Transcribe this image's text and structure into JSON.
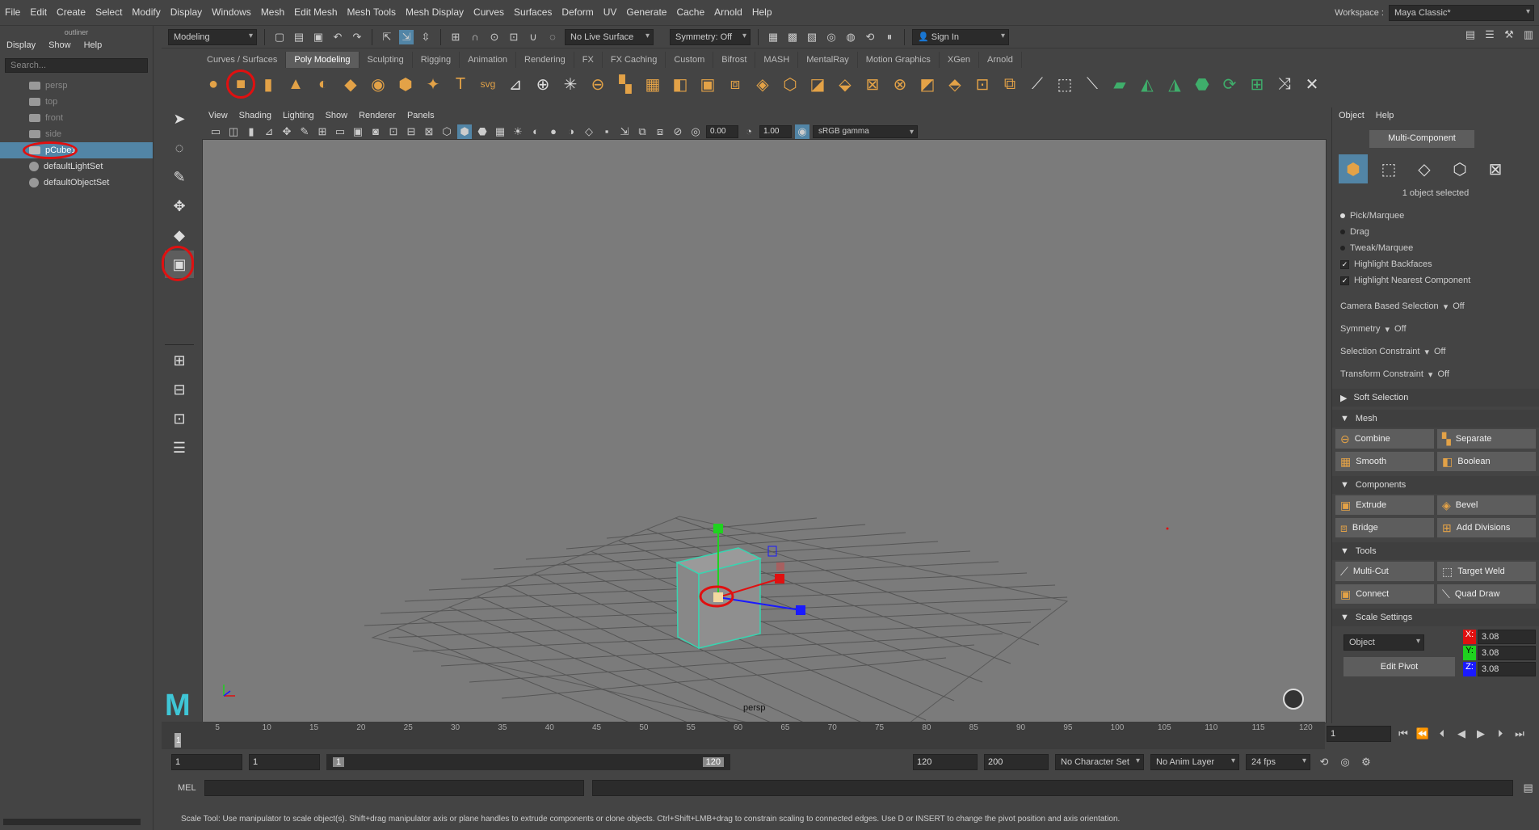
{
  "menubar": {
    "items": [
      "File",
      "Edit",
      "Create",
      "Select",
      "Modify",
      "Display",
      "Windows",
      "Mesh",
      "Edit Mesh",
      "Mesh Tools",
      "Mesh Display",
      "Curves",
      "Surfaces",
      "Deform",
      "UV",
      "Generate",
      "Cache",
      "Arnold",
      "Help"
    ],
    "workspace_label": "Workspace :",
    "workspace_value": "Maya Classic*"
  },
  "statusline": {
    "mode": "Modeling",
    "live_surface": "No Live Surface",
    "symmetry": "Symmetry: Off",
    "sign_in": "Sign In"
  },
  "outliner": {
    "title": "outliner",
    "menu": [
      "Display",
      "Show",
      "Help"
    ],
    "search_placeholder": "Search...",
    "items": [
      {
        "label": "persp",
        "state": "dim"
      },
      {
        "label": "top",
        "state": "dim"
      },
      {
        "label": "front",
        "state": "dim"
      },
      {
        "label": "side",
        "state": "dim"
      },
      {
        "label": "pCube1",
        "state": "selected"
      },
      {
        "label": "defaultLightSet",
        "state": "normal"
      },
      {
        "label": "defaultObjectSet",
        "state": "normal"
      }
    ]
  },
  "shelf": {
    "tabs": [
      "Curves / Surfaces",
      "Poly Modeling",
      "Sculpting",
      "Rigging",
      "Animation",
      "Rendering",
      "FX",
      "FX Caching",
      "Custom",
      "Bifrost",
      "MASH",
      "MentalRay",
      "Motion Graphics",
      "XGen",
      "Arnold"
    ],
    "active_tab": "Poly Modeling"
  },
  "viewport": {
    "menu": [
      "View",
      "Shading",
      "Lighting",
      "Show",
      "Renderer",
      "Panels"
    ],
    "exposure": "0.00",
    "gamma": "1.00",
    "color_space": "sRGB gamma",
    "camera": "persp"
  },
  "tool_settings": {
    "menu": [
      "Object",
      "Help"
    ],
    "mode_button": "Multi-Component",
    "selection_info": "1 object selected",
    "pick_options": [
      "Pick/Marquee",
      "Drag",
      "Tweak/Marquee"
    ],
    "checks": [
      "Highlight Backfaces",
      "Highlight Nearest Component"
    ],
    "rows": [
      {
        "label": "Camera Based Selection",
        "value": "Off"
      },
      {
        "label": "Symmetry",
        "value": "Off"
      },
      {
        "label": "Selection Constraint",
        "value": "Off"
      },
      {
        "label": "Transform Constraint",
        "value": "Off"
      }
    ],
    "soft_selection": "Soft Selection",
    "sections": {
      "mesh": {
        "title": "Mesh",
        "buttons": [
          "Combine",
          "Separate",
          "Smooth",
          "Boolean"
        ]
      },
      "components": {
        "title": "Components",
        "buttons": [
          "Extrude",
          "Bevel",
          "Bridge",
          "Add Divisions"
        ]
      },
      "tools": {
        "title": "Tools",
        "buttons": [
          "Multi-Cut",
          "Target Weld",
          "Connect",
          "Quad Draw"
        ]
      }
    },
    "scale_settings": {
      "title": "Scale Settings",
      "space": "Object",
      "x": "3.08",
      "y": "3.08",
      "z": "3.08",
      "edit_pivot": "Edit Pivot"
    }
  },
  "timeline": {
    "ticks": [
      "5",
      "10",
      "15",
      "20",
      "25",
      "30",
      "35",
      "40",
      "45",
      "50",
      "55",
      "60",
      "65",
      "70",
      "75",
      "80",
      "85",
      "90",
      "95",
      "100",
      "105",
      "110",
      "115",
      "120"
    ],
    "current_frame": "1",
    "frame_field": "1"
  },
  "range": {
    "start": "1",
    "anim_start": "1",
    "slider_start": "1",
    "slider_end": "120",
    "end": "120",
    "anim_end": "200",
    "character_set": "No Character Set",
    "anim_layer": "No Anim Layer",
    "fps": "24 fps"
  },
  "command": {
    "label": "MEL"
  },
  "help_line": "Scale Tool: Use manipulator to scale object(s). Shift+drag manipulator axis or plane handles to extrude components or clone objects. Ctrl+Shift+LMB+drag to constrain scaling to connected edges. Use D or INSERT to change the pivot position and axis orientation.",
  "colors": {
    "panel": "#444444",
    "viewport_bg": "#7b7b7b",
    "selection": "#5285a6",
    "highlight_ring": "#e01010",
    "accent_orange": "#e3a247"
  }
}
